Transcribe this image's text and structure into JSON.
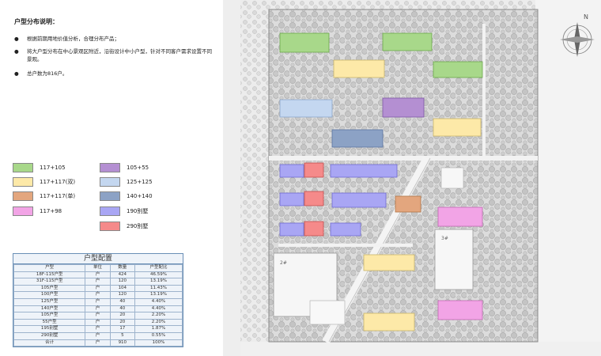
{
  "title": "户型分布说明：",
  "bullets": [
    {
      "dot": "●",
      "text": "根据前期用地价值分析，合理分布产品；"
    },
    {
      "dot": "●",
      "text": "将大户型分布在中心景观区附近，沿街设计中小户型，针对不同客户需求设置不同景观。"
    },
    {
      "dot": "●",
      "text": "总户数为816户。"
    }
  ],
  "legend_left": [
    {
      "label": "117+105",
      "color": "#a8d88a"
    },
    {
      "label": "117+117(双)",
      "color": "#fde9a8"
    },
    {
      "label": "117+117(单)",
      "color": "#e3a67e"
    },
    {
      "label": "117+98",
      "color": "#f2a4e6"
    }
  ],
  "legend_right": [
    {
      "label": "105+55",
      "color": "#b48fd2"
    },
    {
      "label": "125+125",
      "color": "#c4d7f0"
    },
    {
      "label": "140+140",
      "color": "#8ca2c5"
    },
    {
      "label": "190别墅",
      "color": "#a9a6f4"
    },
    {
      "label": "290别墅",
      "color": "#f58a8a"
    }
  ],
  "config_table": {
    "caption": "户型配置",
    "headers": [
      "户型",
      "单位",
      "数量",
      "户型配比"
    ],
    "rows": [
      [
        "18F-115户型",
        "户",
        "424",
        "46.59%"
      ],
      [
        "31F-115户型",
        "户",
        "120",
        "13.19%"
      ],
      [
        "105户型",
        "户",
        "104",
        "11.43%"
      ],
      [
        "100户型",
        "户",
        "120",
        "13.19%"
      ],
      [
        "125户型",
        "户",
        "40",
        "4.40%"
      ],
      [
        "140户型",
        "户",
        "40",
        "4.40%"
      ],
      [
        "105户型",
        "户",
        "20",
        "2.20%"
      ],
      [
        "55户型",
        "户",
        "20",
        "2.20%"
      ],
      [
        "195别墅",
        "户",
        "17",
        "1.87%"
      ],
      [
        "290别墅",
        "户",
        "5",
        "0.55%"
      ],
      [
        "合计",
        "户",
        "910",
        "100%"
      ]
    ]
  },
  "compass": {
    "north": "N"
  },
  "map_labels": {
    "site_a": "2#",
    "site_b": "3#"
  },
  "colors": {
    "green": "#a8d88a",
    "yellow": "#fde9a8",
    "orange": "#e3a67e",
    "pink": "#f2a4e6",
    "purple": "#b48fd2",
    "lightblue": "#c4d7f0",
    "steelblue": "#8ca2c5",
    "villa190": "#a9a6f4",
    "villa290": "#f58a8a"
  }
}
